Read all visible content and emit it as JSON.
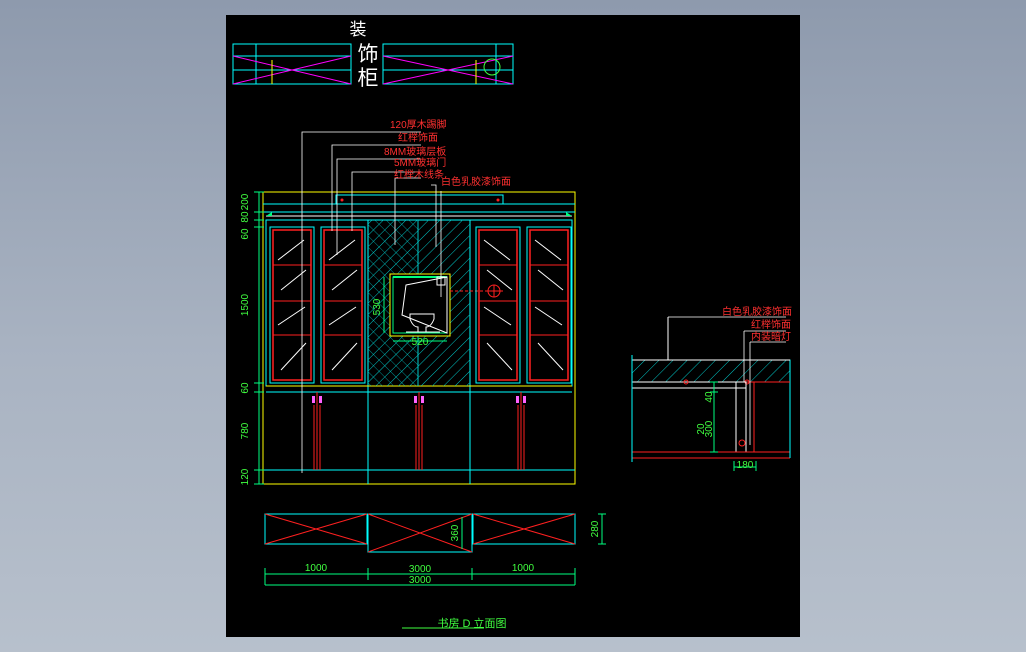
{
  "title_plan": {
    "vertical_chars": [
      "装",
      "饰",
      "柜"
    ]
  },
  "callouts_main": [
    "120厚木踢脚",
    "红榉饰面",
    "8MM玻璃层板",
    "5MM玻璃门",
    "红榉木线条",
    "白色乳胶漆饰面"
  ],
  "callouts_section": [
    "白色乳胶漆饰面",
    "红榉饰面",
    "内装暗灯"
  ],
  "dims_vertical": [
    "200",
    "80",
    "60",
    "1500",
    "60",
    "780",
    "120"
  ],
  "dims_niche": {
    "height": "530",
    "width": "520"
  },
  "dims_section": {
    "v1": "40",
    "v2": "300",
    "v3": "20",
    "h1": "180"
  },
  "plan_depth": "360",
  "plan_side": "280",
  "dims_bottom": {
    "left": "1000",
    "middle": "3000",
    "right": "1000",
    "total": "3000"
  },
  "drawing_title": "书房 D 立面图",
  "colors": {
    "background": "#000000",
    "cyan": "#00ffff",
    "red": "#ff2020",
    "yellow": "#ffff00",
    "green": "#40ff40",
    "magenta": "#ff00ff",
    "white": "#ffffff"
  }
}
